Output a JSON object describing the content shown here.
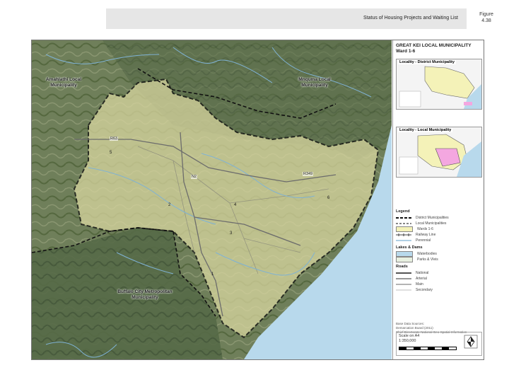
{
  "header": {
    "title": "Status of Housing Projects and Waiting List"
  },
  "figure": {
    "label_line1": "Figure",
    "label_line2": "4.38"
  },
  "map": {
    "places": {
      "amahlathi": "Amahlathi Local Municipality",
      "mnquma": "Mnquma Local Municipality",
      "buffalo_city": "Buffalo City Metropolitan Municipality"
    },
    "wards": [
      "1",
      "2",
      "3",
      "4",
      "5",
      "6"
    ],
    "roads": {
      "r63": "R63",
      "r349": "R349",
      "r2": "N2"
    }
  },
  "panel": {
    "title_line1": "GREAT KEI LOCAL MUNICIPALITY",
    "title_line2": "Ward 1-6",
    "inset1_title": "Locality - District Municipality",
    "inset2_title": "Locality - Local Municipality"
  },
  "legend": {
    "title": "Legend",
    "items": [
      {
        "label": "District Municipalities",
        "symbol": "dash-thick"
      },
      {
        "label": "Local Municipalities",
        "symbol": "dash"
      },
      {
        "label": "Wards 1-6",
        "symbol": "fill-yellow"
      },
      {
        "label": "Railway Line",
        "symbol": "rail"
      },
      {
        "label": "Perennial",
        "symbol": "river"
      }
    ],
    "lakes_title": "Lakes & Dams",
    "lakes_items": [
      {
        "label": "Waterbodies",
        "symbol": "water"
      },
      {
        "label": "Parks & Vleis",
        "symbol": "park"
      }
    ],
    "roads_title": "Roads",
    "roads_items": [
      {
        "label": "National",
        "symbol": "road-national"
      },
      {
        "label": "Arterial",
        "symbol": "road-arterial"
      },
      {
        "label": "Main",
        "symbol": "road-main"
      },
      {
        "label": "Secondary",
        "symbol": "road-secondary"
      }
    ]
  },
  "info": {
    "line1": "Base Data Sources:",
    "line2": "Demarcation Board (2011)",
    "line3": "Chief Directorate National Geo-Spatial Information"
  },
  "scale": {
    "line1": "Scale on A4",
    "line2": "1:350,000",
    "unit": "km"
  },
  "colors": {
    "ward_fill": "#d9d7a0",
    "terrain_dark": "#5a6e4c",
    "terrain_mid": "#7d8a66",
    "sea": "#b8d9ec",
    "river": "#7fb2d4",
    "boundary": "#111111",
    "road": "#6c6c6c",
    "inset_pink": "#f4a7e0",
    "inset_yellow": "#f4f2b8"
  }
}
